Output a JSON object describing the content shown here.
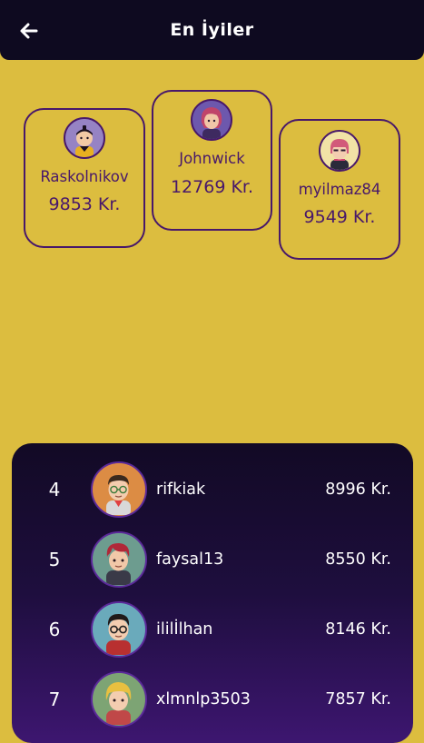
{
  "header": {
    "title": "En İyiler"
  },
  "top3": [
    {
      "position": "left",
      "name": "Raskolnikov",
      "score": "9853 Kr.",
      "avatar_icon": "ninja-avatar-icon"
    },
    {
      "position": "middle",
      "name": "Johnwick",
      "score": "12769 Kr.",
      "avatar_icon": "pink-hair-avatar-icon"
    },
    {
      "position": "right",
      "name": "myilmaz84",
      "score": "9549 Kr.",
      "avatar_icon": "punk-avatar-icon"
    }
  ],
  "list": [
    {
      "rank": "4",
      "name": "rifkiak",
      "score": "8996 Kr.",
      "avatar_icon": "glasses-boy-avatar-icon"
    },
    {
      "rank": "5",
      "name": "faysal13",
      "score": "8550 Kr.",
      "avatar_icon": "red-hair-boy-avatar-icon"
    },
    {
      "rank": "6",
      "name": "ililİlhan",
      "score": "8146 Kr.",
      "avatar_icon": "wizard-boy-avatar-icon"
    },
    {
      "rank": "7",
      "name": "xlmnlp3503",
      "score": "7857 Kr.",
      "avatar_icon": "blonde-boy-avatar-icon"
    }
  ],
  "colors": {
    "background": "#dcbd3f",
    "header_bg": "#0e0a20",
    "accent_purple": "#48186a",
    "list_bg_top": "#120a25",
    "list_bg_bottom": "#3d1670"
  }
}
